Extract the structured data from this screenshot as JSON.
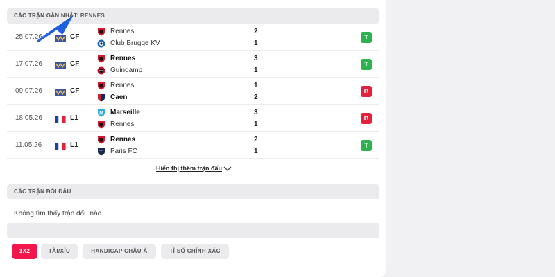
{
  "recent_section": {
    "title": "CÁC TRẬN GẦN NHẤT: RENNES"
  },
  "matches": [
    {
      "date": "25.07.26",
      "competition": "CF",
      "flag": "cf",
      "home": "Rennes",
      "away": "Club Brugge KV",
      "home_score": "2",
      "away_score": "1",
      "home_bold": false,
      "result": "T",
      "result_type": "win",
      "home_crest": "rennes-crest-icon",
      "away_crest": "club-brugge-crest-icon"
    },
    {
      "date": "17.07.26",
      "competition": "CF",
      "flag": "cf",
      "home": "Rennes",
      "away": "Guingamp",
      "home_score": "3",
      "away_score": "1",
      "home_bold": true,
      "result": "T",
      "result_type": "win",
      "home_crest": "rennes-crest-icon",
      "away_crest": "guingamp-crest-icon"
    },
    {
      "date": "09.07.26",
      "competition": "CF",
      "flag": "cf",
      "home": "Rennes",
      "away": "Caen",
      "home_score": "1",
      "away_score": "2",
      "home_bold": false,
      "result": "B",
      "result_type": "loss",
      "home_crest": "rennes-crest-icon",
      "away_crest": "caen-crest-icon"
    },
    {
      "date": "18.05.26",
      "competition": "L1",
      "flag": "fr",
      "home": "Marseille",
      "away": "Rennes",
      "home_score": "3",
      "away_score": "1",
      "home_bold": true,
      "result": "B",
      "result_type": "loss",
      "home_crest": "marseille-crest-icon",
      "away_crest": "rennes-crest-icon"
    },
    {
      "date": "11.05.26",
      "competition": "L1",
      "flag": "fr",
      "home": "Rennes",
      "away": "Paris FC",
      "home_score": "2",
      "away_score": "1",
      "home_bold": true,
      "result": "T",
      "result_type": "win",
      "home_crest": "rennes-crest-icon",
      "away_crest": "paris-fc-crest-icon"
    }
  ],
  "show_more": {
    "label": "Hiển thị thêm trận đấu"
  },
  "h2h_section": {
    "title": "CÁC TRẬN ĐỐI ĐẦU",
    "empty_text": "Không tìm thấy trận đấu nào."
  },
  "tabs": [
    {
      "label": "1X2",
      "active": true
    },
    {
      "label": "TÀI/XỈU",
      "active": false
    },
    {
      "label": "HANDICAP CHÂU Á",
      "active": false
    },
    {
      "label": "TỈ SỐ CHÍNH XÁC",
      "active": false
    }
  ],
  "colors": {
    "accent": "#f2164a",
    "win": "#2eb24f",
    "loss": "#e3213a",
    "annotation_arrow": "#1f5fe0"
  }
}
